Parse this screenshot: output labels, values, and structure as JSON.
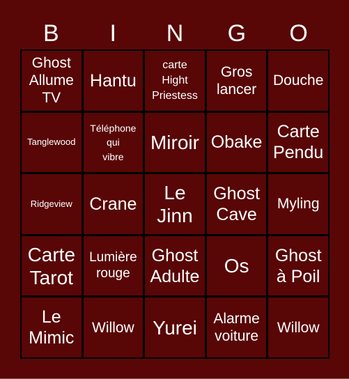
{
  "header": {
    "letters": [
      "B",
      "I",
      "N",
      "G",
      "O"
    ]
  },
  "board": {
    "rows": [
      [
        "Ghost\nAllume\nTV",
        "Hantu",
        "carte\nHight\nPriestess",
        "Gros\nlancer",
        "Douche"
      ],
      [
        "Tanglewood",
        "Téléphone\nqui\nvibre",
        "Miroir",
        "Obake",
        "Carte\nPendu"
      ],
      [
        "Ridgeview",
        "Crane",
        "Le\nJinn",
        "Ghost\nCave",
        "Myling"
      ],
      [
        "Carte\nTarot",
        "Lumière\nrouge",
        "Ghost\nAdulte",
        "Os",
        "Ghost\nà Poil"
      ],
      [
        "Le\nMimic",
        "Willow",
        "Yurei",
        "Alarme\nvoiture",
        "Willow"
      ]
    ]
  },
  "colors": {
    "background": "#580606",
    "grid_lines": "#000000",
    "text": "#ffffff"
  }
}
